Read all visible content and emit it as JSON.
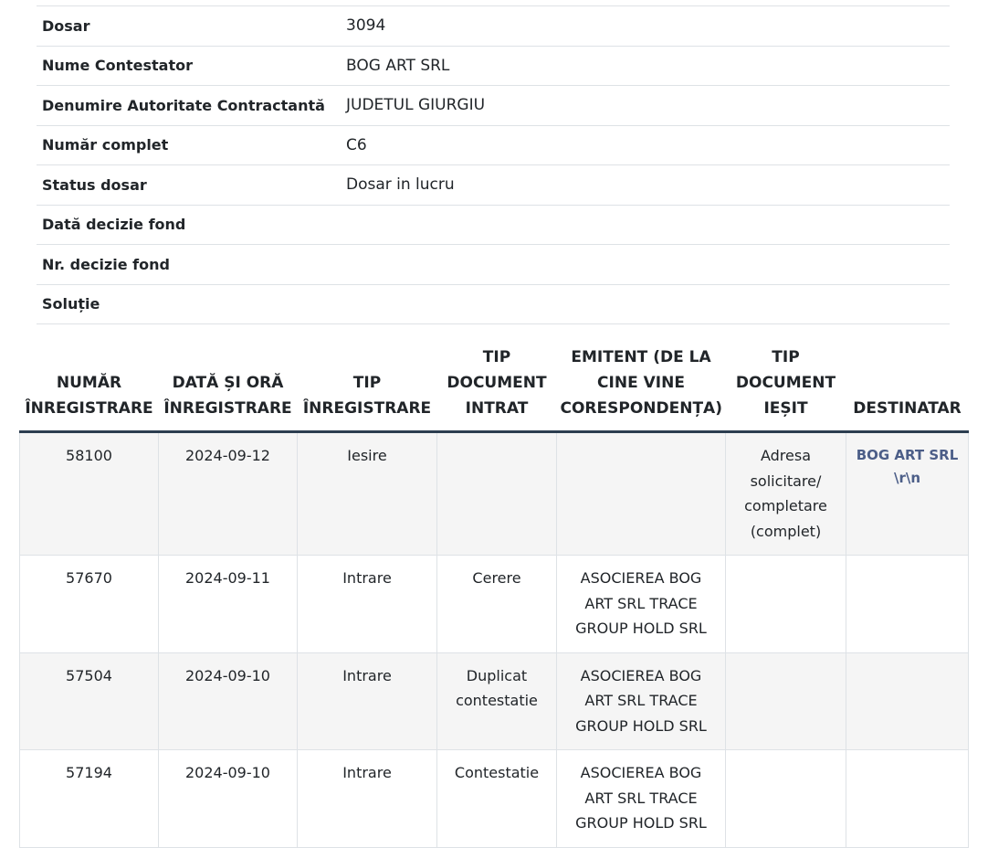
{
  "details": [
    {
      "label": "Dosar",
      "value": "3094"
    },
    {
      "label": "Nume Contestator",
      "value": "BOG ART SRL"
    },
    {
      "label": "Denumire Autoritate Contractantă",
      "value": "JUDETUL GIURGIU"
    },
    {
      "label": "Număr complet",
      "value": "C6"
    },
    {
      "label": "Status dosar",
      "value": "Dosar in lucru"
    },
    {
      "label": "Dată decizie fond",
      "value": ""
    },
    {
      "label": "Nr. decizie fond",
      "value": ""
    },
    {
      "label": "Soluție",
      "value": ""
    }
  ],
  "registry": {
    "headers": [
      "NUMĂR ÎNREGISTRARE",
      "DATĂ ȘI ORĂ ÎNREGISTRARE",
      "TIP ÎNREGISTRARE",
      "TIP DOCUMENT INTRAT",
      "EMITENT (DE LA CINE VINE CORESPONDENȚA)",
      "TIP DOCUMENT IEȘIT",
      "DESTINATAR"
    ],
    "rows": [
      {
        "numar": "58100",
        "data": "2024-09-12",
        "tip": "Iesire",
        "doc_intrat": "",
        "emitent": "",
        "doc_iesit": "Adresa solicitare/ completare (complet)",
        "destinatar": "BOG ART SRL \\r\\n"
      },
      {
        "numar": "57670",
        "data": "2024-09-11",
        "tip": "Intrare",
        "doc_intrat": "Cerere",
        "emitent": "ASOCIEREA BOG ART SRL TRACE GROUP HOLD SRL",
        "doc_iesit": "",
        "destinatar": ""
      },
      {
        "numar": "57504",
        "data": "2024-09-10",
        "tip": "Intrare",
        "doc_intrat": "Duplicat contestatie",
        "emitent": "ASOCIEREA BOG ART SRL TRACE GROUP HOLD SRL",
        "doc_iesit": "",
        "destinatar": ""
      },
      {
        "numar": "57194",
        "data": "2024-09-10",
        "tip": "Intrare",
        "doc_intrat": "Contestatie",
        "emitent": "ASOCIEREA BOG ART SRL TRACE GROUP HOLD SRL",
        "doc_iesit": "",
        "destinatar": ""
      }
    ]
  }
}
